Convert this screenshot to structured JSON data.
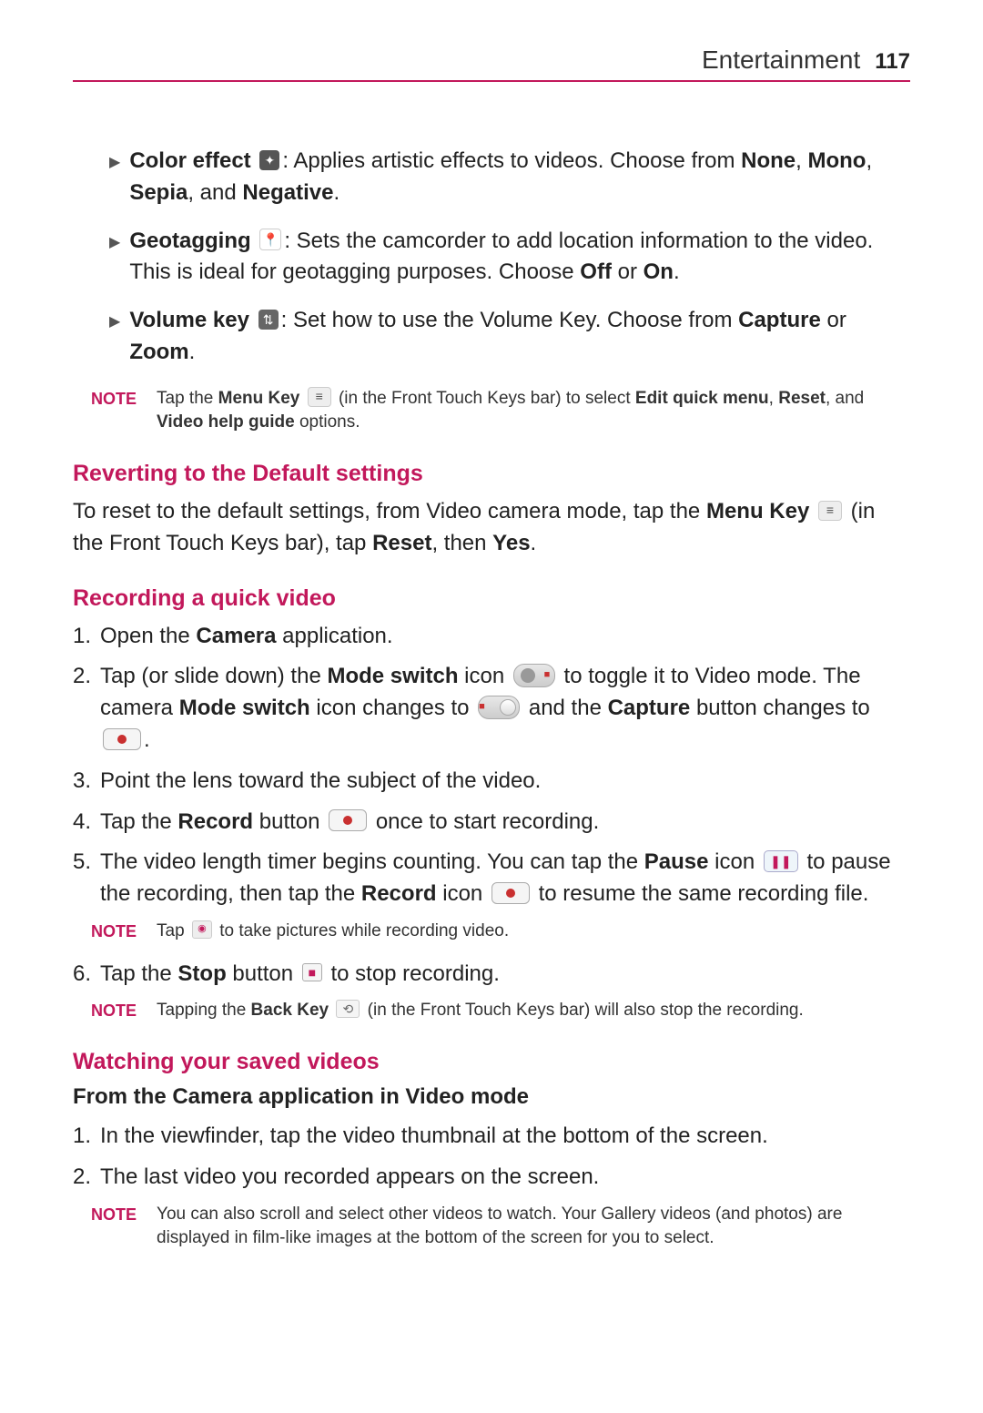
{
  "header": {
    "section": "Entertainment",
    "page": "117"
  },
  "bullets": {
    "color_effect": {
      "label": "Color effect",
      "desc": ": Applies artistic effects to videos. Choose from ",
      "opt1": "None",
      "sep1": ", ",
      "opt2": "Mono",
      "sep2": ", ",
      "opt3": "Sepia",
      "sep3": ", and ",
      "opt4": "Negative",
      "tail": "."
    },
    "geotagging": {
      "label": "Geotagging",
      "desc": ": Sets the camcorder to add location information to the video. This is ideal for geotagging purposes. Choose ",
      "opt1": "Off",
      "sep1": " or ",
      "opt2": "On",
      "tail": "."
    },
    "volume_key": {
      "label": "Volume key",
      "desc": ": Set how to use the Volume Key. Choose from ",
      "opt1": "Capture",
      "sep1": " or ",
      "opt2": "Zoom",
      "tail": "."
    }
  },
  "note1": {
    "label": "NOTE",
    "t1": "Tap the ",
    "b1": "Menu Key",
    "t2": " (in the Front Touch Keys bar) to select ",
    "b2": "Edit quick menu",
    "sep1": ", ",
    "b3": "Reset",
    "sep2": ", and ",
    "b4": "Video help guide",
    "tail": " options."
  },
  "revert": {
    "heading": "Reverting to the Default settings",
    "t1": "To reset to the default settings, from Video camera mode, tap the ",
    "b1": "Menu Key",
    "t2": " (in the Front Touch Keys bar), tap ",
    "b2": "Reset",
    "t3": ", then ",
    "b3": "Yes",
    "tail": "."
  },
  "recording": {
    "heading": "Recording a quick video",
    "step1": {
      "n": "1.",
      "t1": "Open the ",
      "b1": "Camera",
      "t2": " application."
    },
    "step2": {
      "n": "2.",
      "t1": "Tap (or slide down) the ",
      "b1": "Mode switch",
      "t2": " icon ",
      "t3": " to toggle it to Video mode. The camera ",
      "b2": "Mode switch",
      "t4": " icon changes to ",
      "t5": " and the ",
      "b3": "Capture",
      "t6": " button changes to ",
      "tail": "."
    },
    "step3": {
      "n": "3.",
      "t1": "Point the lens toward the subject of the video."
    },
    "step4": {
      "n": "4.",
      "t1": "Tap the ",
      "b1": "Record",
      "t2": " button ",
      "t3": " once to start recording."
    },
    "step5": {
      "n": "5.",
      "t1": "The video length timer begins counting. You can tap the ",
      "b1": "Pause",
      "t2": " icon ",
      "t3": " to pause the recording, then tap the ",
      "b2": "Record",
      "t4": " icon ",
      "t5": " to resume the same recording file."
    },
    "note_cam": {
      "label": "NOTE",
      "t1": "Tap ",
      "t2": " to take pictures while recording video."
    },
    "step6": {
      "n": "6.",
      "t1": "Tap the ",
      "b1": "Stop",
      "t2": " button ",
      "t3": " to stop recording."
    },
    "note_back": {
      "label": "NOTE",
      "t1": "Tapping the ",
      "b1": "Back Key",
      "t2": " (in the Front Touch Keys bar) will also stop the recording."
    }
  },
  "watching": {
    "heading": "Watching your saved videos",
    "sub": "From the Camera application in Video mode",
    "step1": {
      "n": "1.",
      "t1": "In the viewfinder, tap the video thumbnail at the bottom of the screen."
    },
    "step2": {
      "n": "2.",
      "t1": "The last video you recorded appears on the screen."
    },
    "note": {
      "label": "NOTE",
      "t1": "You can also scroll and select other videos to watch. Your Gallery videos (and photos) are displayed in film-like images at the bottom of the screen for you to select."
    }
  }
}
